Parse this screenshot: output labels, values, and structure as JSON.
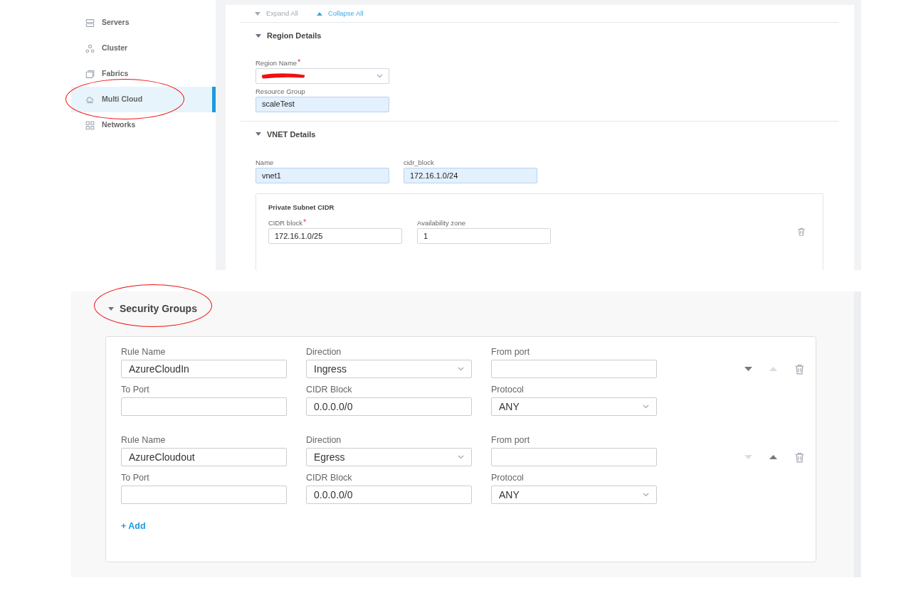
{
  "sidebar": {
    "items": [
      {
        "label": "Servers",
        "selected": false,
        "annotated": false
      },
      {
        "label": "Cluster",
        "selected": false,
        "annotated": false
      },
      {
        "label": "Fabrics",
        "selected": false,
        "annotated": false
      },
      {
        "label": "Multi Cloud",
        "selected": true,
        "annotated": true
      },
      {
        "label": "Networks",
        "selected": false,
        "annotated": false
      }
    ]
  },
  "toolbar": [
    {
      "label": "Expand All",
      "kind": "expand",
      "disabled": true
    },
    {
      "label": "Collapse All",
      "kind": "collapse",
      "disabled": false
    }
  ],
  "region_details": {
    "title": "Region Details",
    "expanded": true,
    "fields": [
      {
        "label": "Region Name",
        "required_mark": "*",
        "kind": "select",
        "redacted": true,
        "highlighted": false
      },
      {
        "label": "Resource Group",
        "value": "scaleTest",
        "kind": "text",
        "highlighted": true
      }
    ]
  },
  "vnet_details": {
    "title": "VNET Details",
    "expanded": true,
    "fields": [
      {
        "label": "Name",
        "value": "vnet1",
        "highlighted": true
      },
      {
        "label": "cidr_block",
        "value": "172.16.1.0/24",
        "highlighted": true
      }
    ],
    "subnet": {
      "title": "Private Subnet CIDR",
      "fields": [
        {
          "label": "CIDR block",
          "required_mark": "*",
          "value": "172.16.1.0/25"
        },
        {
          "label": "Availability zone",
          "value": "1"
        }
      ]
    }
  },
  "security_groups": {
    "title": "Security Groups",
    "expanded": true,
    "annotated": true,
    "rules": [
      {
        "rule_name": {
          "label": "Rule Name",
          "value": "AzureCloudIn"
        },
        "direction": {
          "label": "Direction",
          "value": "Ingress"
        },
        "from_port": {
          "label": "From port"
        },
        "to_port": {
          "label": "To Port"
        },
        "cidr_block": {
          "label": "CIDR Block",
          "value": "0.0.0.0/0"
        },
        "protocol": {
          "label": "Protocol",
          "value": "ANY"
        },
        "can_move_down": true,
        "can_move_up": false
      },
      {
        "rule_name": {
          "label": "Rule Name",
          "value": "AzureCloudout"
        },
        "direction": {
          "label": "Direction",
          "value": "Egress"
        },
        "from_port": {
          "label": "From port"
        },
        "to_port": {
          "label": "To Port"
        },
        "cidr_block": {
          "label": "CIDR Block",
          "value": "0.0.0.0/0"
        },
        "protocol": {
          "label": "Protocol",
          "value": "ANY"
        },
        "can_move_down": false,
        "can_move_up": true
      }
    ],
    "add_label": "+ Add"
  }
}
